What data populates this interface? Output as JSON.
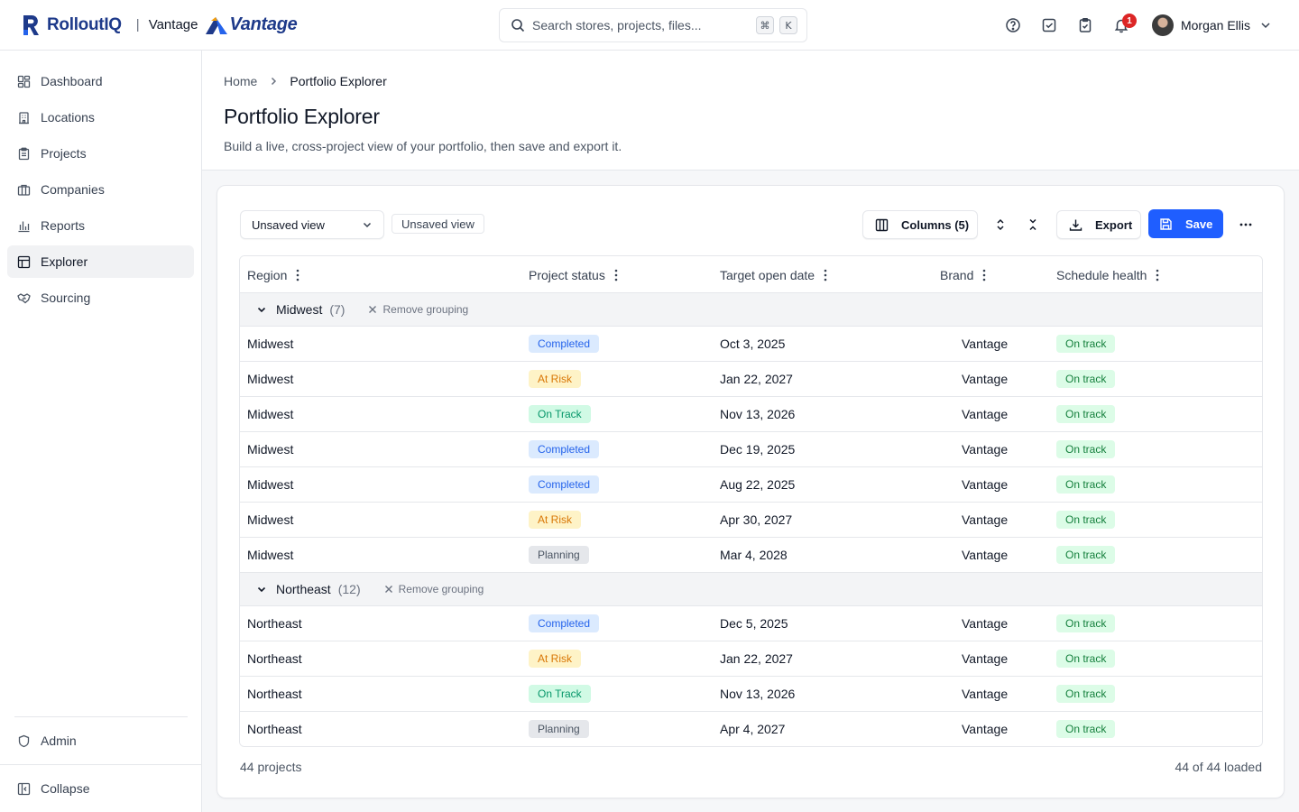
{
  "app": {
    "name": "RolloutIQ",
    "separator": "|",
    "tenant": "Vantage",
    "tenant_logo_text": "Vantage"
  },
  "search": {
    "placeholder": "Search stores, projects, files...",
    "shortcut": [
      "⌘",
      "K"
    ]
  },
  "notifications": {
    "count": "1"
  },
  "user": {
    "name": "Morgan Ellis"
  },
  "sidebar": {
    "items": [
      {
        "id": "dashboard",
        "label": "Dashboard",
        "icon": "dashboard-icon"
      },
      {
        "id": "locations",
        "label": "Locations",
        "icon": "building-icon"
      },
      {
        "id": "projects",
        "label": "Projects",
        "icon": "clipboard-icon"
      },
      {
        "id": "companies",
        "label": "Companies",
        "icon": "briefcase-icon"
      },
      {
        "id": "reports",
        "label": "Reports",
        "icon": "bar-chart-icon"
      },
      {
        "id": "explorer",
        "label": "Explorer",
        "icon": "table-icon",
        "active": true
      },
      {
        "id": "sourcing",
        "label": "Sourcing",
        "icon": "handshake-icon"
      }
    ],
    "admin": "Admin",
    "collapse": "Collapse"
  },
  "breadcrumb": {
    "home": "Home",
    "current": "Portfolio Explorer"
  },
  "page": {
    "title": "Portfolio Explorer",
    "subtitle": "Build a live, cross-project view of your portfolio, then save and export it."
  },
  "toolbar": {
    "view_select": "Unsaved view",
    "view_chip": "Unsaved view",
    "columns": "Columns (5)",
    "export": "Export",
    "save": "Save"
  },
  "table": {
    "columns": [
      "Region",
      "Project status",
      "Target open date",
      "Brand",
      "Schedule health"
    ],
    "remove_grouping": "Remove grouping",
    "groups": [
      {
        "name": "Midwest",
        "count": "(7)",
        "rows": [
          {
            "region": "Midwest",
            "status": "Completed",
            "date": "Oct 3, 2025",
            "brand": "Vantage",
            "health": "On track"
          },
          {
            "region": "Midwest",
            "status": "At Risk",
            "date": "Jan 22, 2027",
            "brand": "Vantage",
            "health": "On track"
          },
          {
            "region": "Midwest",
            "status": "On Track",
            "date": "Nov 13, 2026",
            "brand": "Vantage",
            "health": "On track"
          },
          {
            "region": "Midwest",
            "status": "Completed",
            "date": "Dec 19, 2025",
            "brand": "Vantage",
            "health": "On track"
          },
          {
            "region": "Midwest",
            "status": "Completed",
            "date": "Aug 22, 2025",
            "brand": "Vantage",
            "health": "On track"
          },
          {
            "region": "Midwest",
            "status": "At Risk",
            "date": "Apr 30, 2027",
            "brand": "Vantage",
            "health": "On track"
          },
          {
            "region": "Midwest",
            "status": "Planning",
            "date": "Mar 4, 2028",
            "brand": "Vantage",
            "health": "On track"
          }
        ]
      },
      {
        "name": "Northeast",
        "count": "(12)",
        "rows": [
          {
            "region": "Northeast",
            "status": "Completed",
            "date": "Dec 5, 2025",
            "brand": "Vantage",
            "health": "On track"
          },
          {
            "region": "Northeast",
            "status": "At Risk",
            "date": "Jan 22, 2027",
            "brand": "Vantage",
            "health": "On track"
          },
          {
            "region": "Northeast",
            "status": "On Track",
            "date": "Nov 13, 2026",
            "brand": "Vantage",
            "health": "On track"
          },
          {
            "region": "Northeast",
            "status": "Planning",
            "date": "Apr 4, 2027",
            "brand": "Vantage",
            "health": "On track"
          }
        ]
      }
    ]
  },
  "status_colors": {
    "Completed": {
      "bg": "#dbeafe",
      "fg": "#2563eb"
    },
    "At Risk": {
      "bg": "#fef3c7",
      "fg": "#d97706"
    },
    "On Track": {
      "bg": "#d1fae5",
      "fg": "#059669"
    },
    "Planning": {
      "bg": "#e5e7eb",
      "fg": "#4b5563"
    },
    "On track": {
      "bg": "#dcfce7",
      "fg": "#15803d"
    }
  },
  "footer": {
    "count": "44 projects",
    "loaded": "44 of 44 loaded"
  },
  "colors": {
    "accent": "#1f5eff",
    "brand": "#1e3a8a",
    "badge": "#dc2626"
  }
}
